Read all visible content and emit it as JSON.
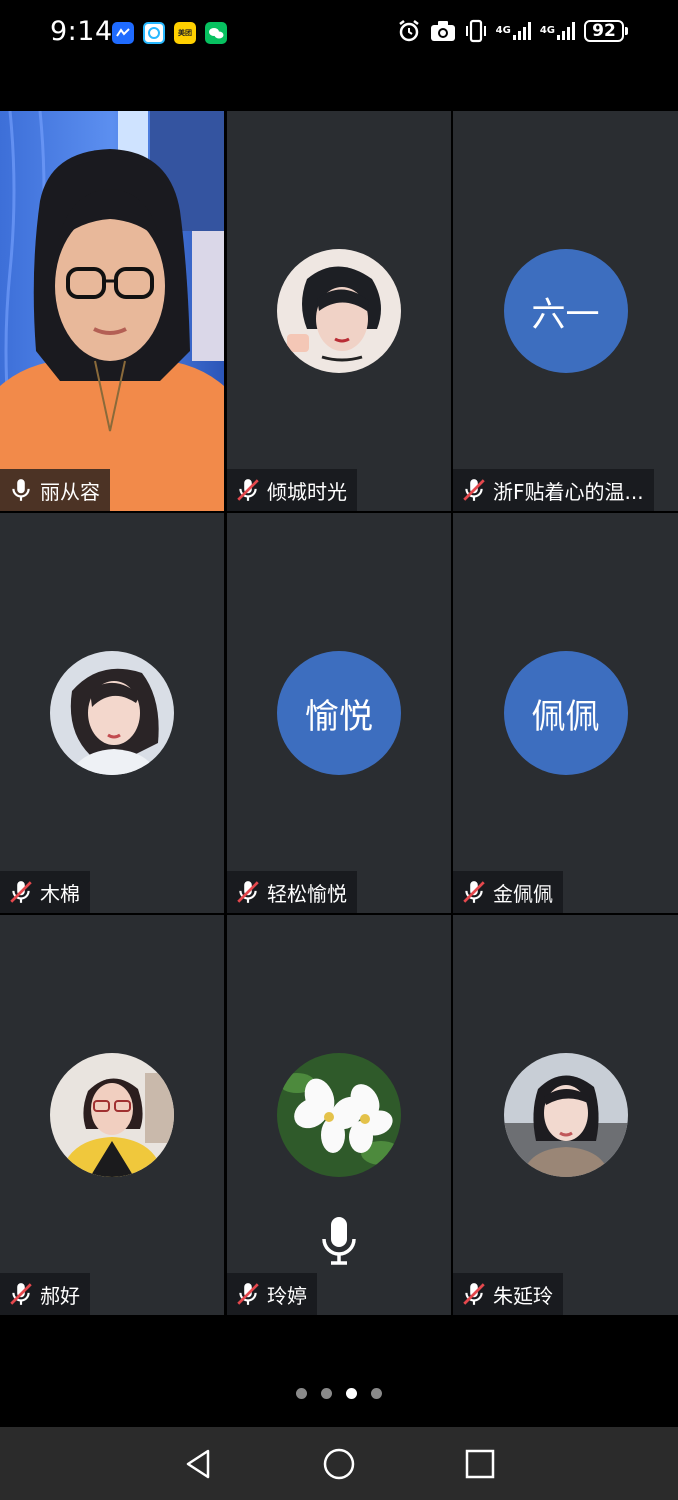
{
  "status_bar": {
    "time": "9:14",
    "apps": [
      {
        "name": "feishu-icon",
        "label": ""
      },
      {
        "name": "chat-icon",
        "label": ""
      },
      {
        "name": "meituan-icon",
        "label": "美团"
      },
      {
        "name": "wechat-icon",
        "label": ""
      }
    ],
    "network1": "4G",
    "network2": "4G",
    "battery": "92"
  },
  "participants": [
    {
      "name": "丽从容",
      "mic": "on",
      "display": "video"
    },
    {
      "name": "倾城时光",
      "mic": "muted",
      "display": "photo"
    },
    {
      "name": "浙F贴着心的温...",
      "mic": "muted",
      "display": "initials",
      "initials": "六一"
    },
    {
      "name": "木棉",
      "mic": "muted",
      "display": "photo"
    },
    {
      "name": "轻松愉悦",
      "mic": "muted",
      "display": "initials",
      "initials": "愉悦"
    },
    {
      "name": "金佩佩",
      "mic": "muted",
      "display": "initials",
      "initials": "佩佩"
    },
    {
      "name": "郝好",
      "mic": "muted",
      "display": "photo"
    },
    {
      "name": "玲婷",
      "mic": "muted",
      "display": "photo",
      "speaking": true
    },
    {
      "name": "朱延玲",
      "mic": "muted",
      "display": "photo"
    }
  ],
  "pagination": {
    "total": 4,
    "active": 3
  },
  "colors": {
    "tile_bg": "#2a2d31",
    "initials_bg": "#3d6ebf",
    "muted_red": "#e5484d"
  }
}
